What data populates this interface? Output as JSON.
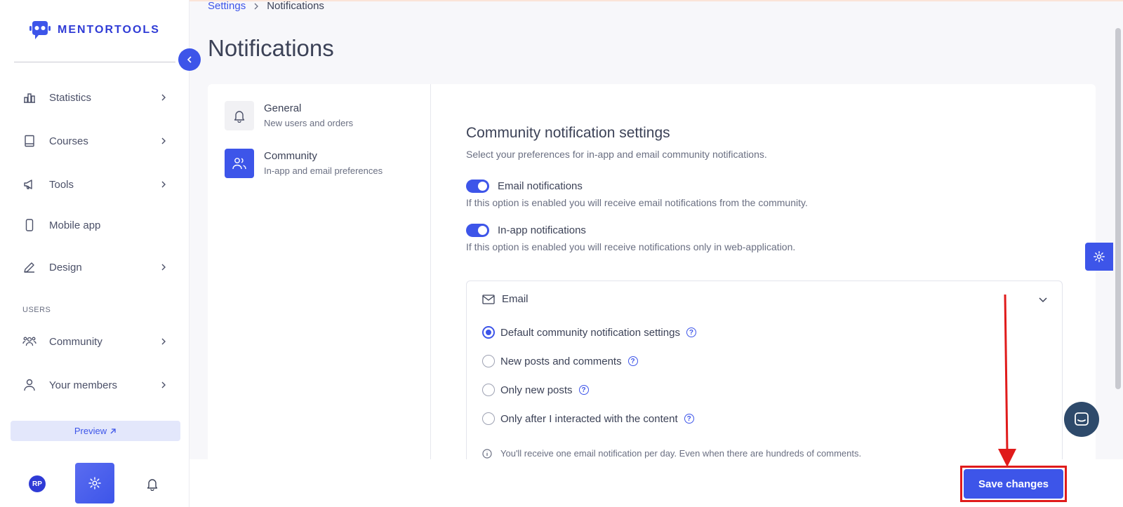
{
  "brand": {
    "name": "MENTORTOOLS"
  },
  "sidebar": {
    "items": [
      {
        "label": "Statistics",
        "icon": "bar-chart-icon",
        "chevron": true
      },
      {
        "label": "Courses",
        "icon": "book-icon",
        "chevron": true
      },
      {
        "label": "Tools",
        "icon": "megaphone-icon",
        "chevron": true
      },
      {
        "label": "Mobile app",
        "icon": "phone-icon",
        "chevron": false
      },
      {
        "label": "Design",
        "icon": "pen-icon",
        "chevron": true
      }
    ],
    "section_label": "USERS",
    "user_items": [
      {
        "label": "Community",
        "icon": "people-icon",
        "chevron": true
      },
      {
        "label": "Your members",
        "icon": "person-icon",
        "chevron": true
      }
    ],
    "preview_label": "Preview",
    "avatar_initials": "RP"
  },
  "breadcrumb": {
    "parent": "Settings",
    "current": "Notifications"
  },
  "page_title": "Notifications",
  "categories": [
    {
      "title": "General",
      "subtitle": "New users and orders",
      "icon": "bell-icon",
      "active": false
    },
    {
      "title": "Community",
      "subtitle": "In-app and email preferences",
      "icon": "people-icon",
      "active": true
    }
  ],
  "community": {
    "heading": "Community notification settings",
    "description": "Select your preferences for in-app and email community notifications.",
    "toggles": [
      {
        "label": "Email notifications",
        "description": "If this option is enabled you will receive email notifications from the community.",
        "on": true
      },
      {
        "label": "In-app notifications",
        "description": "If this option is enabled you will receive notifications only in web-application.",
        "on": true
      }
    ],
    "email_section": {
      "title": "Email",
      "options": [
        {
          "label": "Default community notification settings",
          "checked": true
        },
        {
          "label": "New posts and comments",
          "checked": false
        },
        {
          "label": "Only new posts",
          "checked": false
        },
        {
          "label": "Only after I interacted with the content",
          "checked": false
        }
      ],
      "info": "You'll receive one email notification per day. Even when there are hundreds of comments."
    }
  },
  "save_label": "Save changes",
  "colors": {
    "accent": "#3d55e9",
    "highlight": "#e01b1b"
  }
}
